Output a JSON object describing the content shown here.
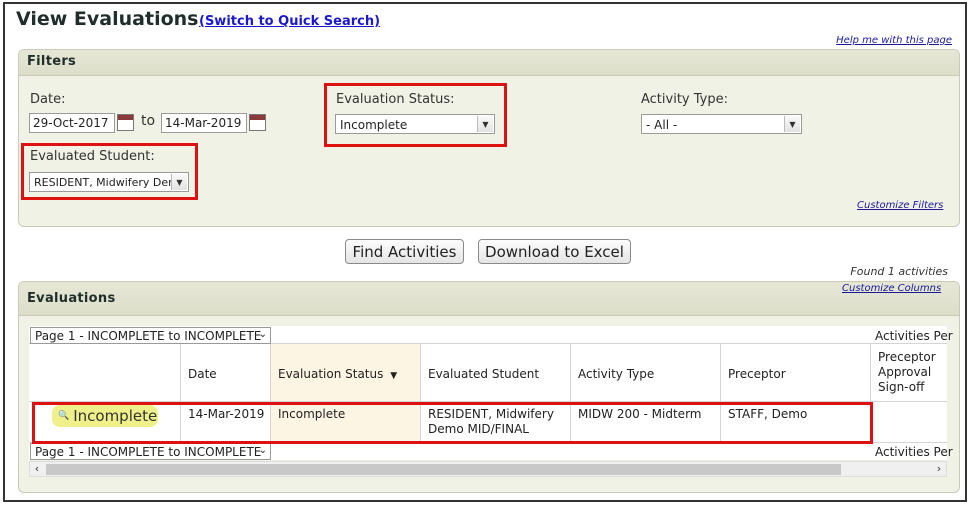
{
  "header": {
    "title": "View Evaluations",
    "quick_search_link": "(Switch to Quick Search)",
    "help_link": "Help me with this page"
  },
  "filters": {
    "title": "Filters",
    "date_label": "Date:",
    "date_from": "29-Oct-2017",
    "to_label": "to",
    "date_to": "14-Mar-2019",
    "status_label": "Evaluation Status:",
    "status_value": "Incomplete",
    "activity_label": "Activity Type:",
    "activity_value": "- All -",
    "student_label": "Evaluated Student:",
    "student_value": "RESIDENT, Midwifery Der",
    "customize_link": "Customize Filters"
  },
  "actions": {
    "find_label": "Find Activities",
    "download_label": "Download to Excel"
  },
  "results": {
    "found_text": "Found 1 activities",
    "title": "Evaluations",
    "customize_columns": "Customize Columns",
    "pager_top": "Page 1 - INCOMPLETE to INCOMPLETE",
    "pager_bottom": "Page 1 - INCOMPLETE to INCOMPLETE",
    "activities_per_top": "Activities Per",
    "activities_per_bottom": "Activities Per"
  },
  "table": {
    "columns": [
      "Date",
      "Evaluation Status",
      "Evaluated Student",
      "Activity Type",
      "Preceptor",
      "Preceptor Approval Sign-off"
    ],
    "sort_indicator": "▼",
    "rows": [
      {
        "action": "Incomplete",
        "date": "14-Mar-2019",
        "status": "Incomplete",
        "student_line1": "RESIDENT, Midwifery",
        "student_line2": "Demo MID/FINAL",
        "activity": "MIDW 200 - Midterm",
        "preceptor": "STAFF, Demo",
        "signoff": ""
      }
    ]
  },
  "colors": {
    "highlight": "#dd1111",
    "panel_bg": "#f1f2e6",
    "link": "#1a1acc",
    "button_highlight": "#f0f08a"
  },
  "icons": [
    "calendar-icon",
    "chevron-down-icon",
    "magnifier-icon",
    "scroll-left-icon",
    "scroll-right-icon"
  ]
}
